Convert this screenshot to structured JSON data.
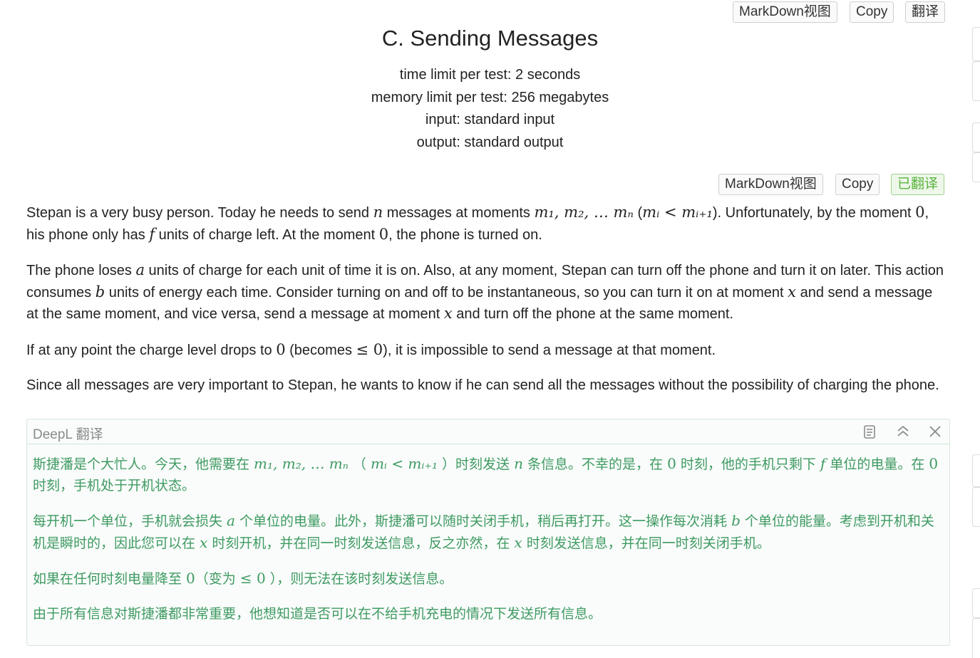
{
  "toolbar_top": {
    "markdown": "MarkDown视图",
    "copy": "Copy",
    "translate": "翻译"
  },
  "toolbar_statement": {
    "markdown": "MarkDown视图",
    "copy": "Copy",
    "translated": "已翻译"
  },
  "problem": {
    "title": "C. Sending Messages",
    "time_limit": "time limit per test: 2 seconds",
    "memory_limit": "memory limit per test: 256 megabytes",
    "input": "input: standard input",
    "output": "output: standard output"
  },
  "statement": {
    "p1": {
      "t1": "Stepan is a very busy person. Today he needs to send ",
      "n": "n",
      "t2": " messages at moments ",
      "moments": "m₁, m₂, … mₙ",
      "t3": " (",
      "ineq": "mᵢ < mᵢ₊₁",
      "t4": "). Unfortunately, by the moment ",
      "zero": "0",
      "t5": ", his phone only has ",
      "f": "f",
      "t6": " units of charge left. At the moment ",
      "zero2": "0",
      "t7": ", the phone is turned on."
    },
    "p2": {
      "t1": "The phone loses ",
      "a": "a",
      "t2": " units of charge for each unit of time it is on. Also, at any moment, Stepan can turn off the phone and turn it on later. This action consumes ",
      "b": "b",
      "t3": " units of energy each time. Consider turning on and off to be instantaneous, so you can turn it on at moment ",
      "x": "x",
      "t4": " and send a message at the same moment, and vice versa, send a message at moment ",
      "x2": "x",
      "t5": " and turn off the phone at the same moment."
    },
    "p3": {
      "t1": "If at any point the charge level drops to ",
      "zero": "0",
      "t2": " (becomes ",
      "le": "≤ 0",
      "t3": "), it is impossible to send a message at that moment."
    },
    "p4": {
      "t1": "Since all messages are very important to Stepan, he wants to know if he can send all the messages without the possibility of charging the phone."
    }
  },
  "deepl": {
    "title": "DeepL 翻译",
    "icons": [
      "copy-icon",
      "collapse-icon",
      "close-icon"
    ],
    "p1": {
      "t1": "斯捷潘是个大忙人。今天，他需要在 ",
      "moments": "m₁, m₂, … mₙ",
      "t2": " （ ",
      "ineq": "mᵢ < mᵢ₊₁",
      "t3": " ）时刻发送 ",
      "n": "n",
      "t4": " 条信息。不幸的是，在 ",
      "zero": "0",
      "t5": " 时刻，他的手机只剩下 ",
      "f": "f",
      "t6": " 单位的电量。在 ",
      "zero2": "0",
      "t7": " 时刻，手机处于开机状态。"
    },
    "p2": {
      "t1": "每开机一个单位，手机就会损失 ",
      "a": "a",
      "t2": " 个单位的电量。此外，斯捷潘可以随时关闭手机，稍后再打开。这一操作每次消耗 ",
      "b": "b",
      "t3": " 个单位的能量。考虑到开机和关机是瞬时的，因此您可以在 ",
      "x": "x",
      "t4": " 时刻开机，并在同一时刻发送信息，反之亦然，在 ",
      "x2": "x",
      "t5": " 时刻发送信息，并在同一时刻关闭手机。"
    },
    "p3": {
      "t1": "如果在任何时刻电量降至 ",
      "zero": "0",
      "t2": "（变为 ",
      "le": "≤ 0",
      "t3": " ），则无法在该时刻发送信息。"
    },
    "p4": {
      "t1": "由于所有信息对斯捷潘都非常重要，他想知道是否可以在不给手机充电的情况下发送所有信息。"
    }
  },
  "colors": {
    "translation_text": "#3f9a63",
    "translated_button": "#5ab33e",
    "box_border": "#d3e8dc"
  }
}
